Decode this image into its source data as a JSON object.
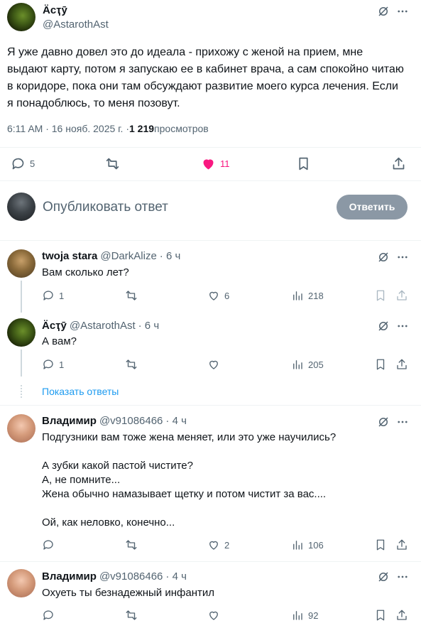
{
  "main_tweet": {
    "author_name": "Ӓсҭӯ",
    "author_handle": "@AstarothAst",
    "text": "Я уже давно довел это до идеала - прихожу с женой на прием, мне выдают карту, потом я запускаю ее в кабинет врача, а сам спокойно читаю в коридоре, пока они там обсуждают развитие моего курса лечения. Если я понадоблюсь, то меня позовут.",
    "time": "6:11 AM · 16 нояб. 2025 г. · ",
    "views_count": "1 219",
    "views_label": " просмотров",
    "replies": "5",
    "likes": "11",
    "like_color": "#f91880"
  },
  "composer": {
    "placeholder": "Опубликовать ответ",
    "button_label": "Ответить"
  },
  "replies": [
    {
      "name": "twoja stara",
      "handle": "@DarkAlize",
      "time": "· 6 ч",
      "text": "Вам сколько лет?",
      "replies": "1",
      "likes": "6",
      "views": "218"
    },
    {
      "name": "Ӓсҭӯ",
      "handle": "@AstarothAst",
      "time": "· 6 ч",
      "text": "А вам?",
      "replies": "1",
      "likes": "",
      "views": "205"
    },
    {
      "name": "Владимир",
      "handle": "@v91086466",
      "time": "· 4 ч",
      "lines": [
        "Подгузники вам тоже жена меняет, или это уже научились?",
        "",
        "А зубки какой пастой чистите?",
        "А, не помните...",
        "Жена обычно намазывает щетку и потом чистит за вас....",
        "",
        "Ой, как неловко, конечно..."
      ],
      "likes": "2",
      "views": "106"
    },
    {
      "name": "Владимир",
      "handle": "@v91086466",
      "time": "· 4 ч",
      "text": "Охуеть ты безнадежный инфантил",
      "views": "92"
    }
  ],
  "show_replies": "Показать ответы",
  "colors": {
    "link": "#1d9bf0",
    "muted": "#536471",
    "button_bg": "#8b98a5"
  }
}
